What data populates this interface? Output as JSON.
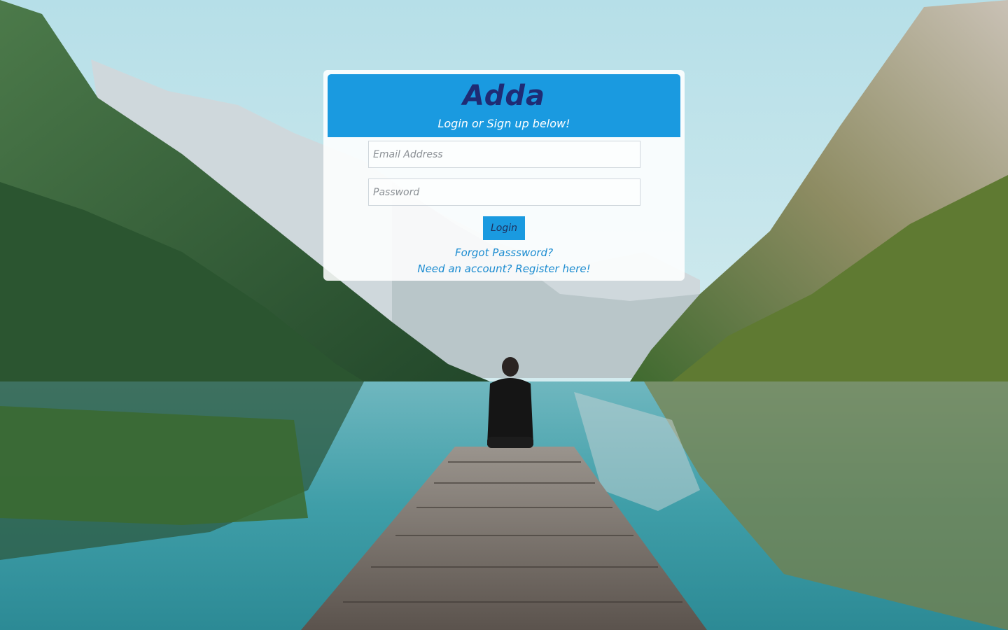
{
  "app": {
    "title": "Adda",
    "subtitle": "Login or Sign up below!"
  },
  "form": {
    "email_placeholder": "Email Address",
    "email_value": "",
    "password_placeholder": "Password",
    "password_value": "",
    "login_label": "Login",
    "forgot_label": "Forgot Passsword?",
    "register_label": "Need an account? Register here!"
  },
  "colors": {
    "header": "#1a9ae0",
    "title": "#1f2b74",
    "link": "#1a8bd0",
    "button": "#1a9ae0"
  },
  "background": {
    "description_icon": "mountain-lake-photo"
  }
}
